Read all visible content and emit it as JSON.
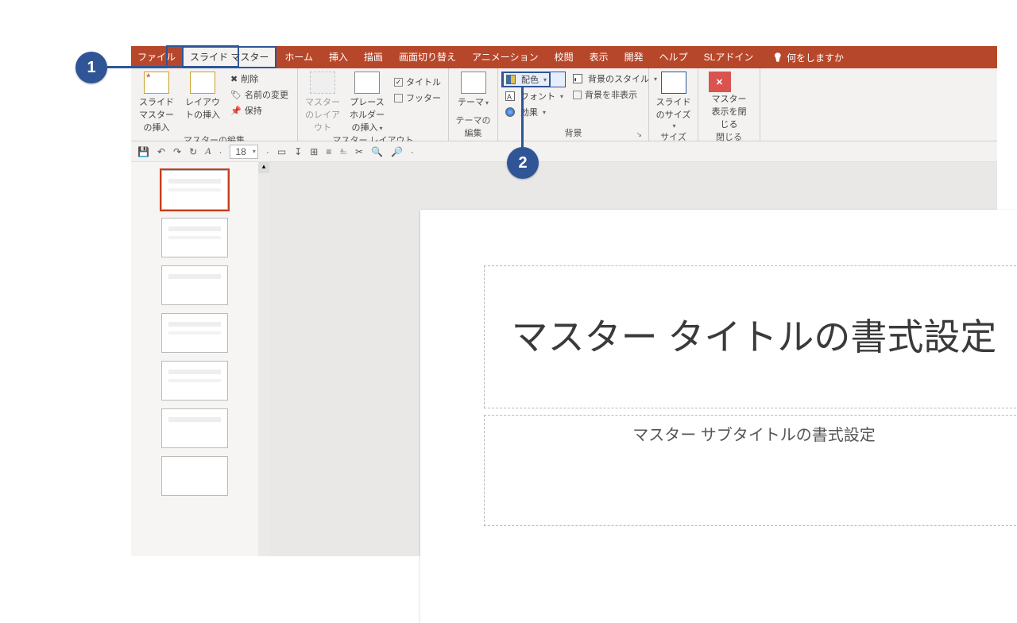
{
  "tabs": {
    "file": "ファイル",
    "slidemaster": "スライド マスター",
    "home": "ホーム",
    "insert": "挿入",
    "draw": "描画",
    "transition": "画面切り替え",
    "animation": "アニメーション",
    "review": "校閲",
    "view": "表示",
    "developer": "開発",
    "help": "ヘルプ",
    "sladdin": "SLアドイン",
    "tellme": "何をしますか"
  },
  "ribbon": {
    "editMaster": {
      "insertSlideMaster": "スライド マスターの挿入",
      "insertLayout": "レイアウトの挿入",
      "delete": "削除",
      "rename": "名前の変更",
      "preserve": "保持",
      "group": "マスターの編集"
    },
    "masterLayout": {
      "masterLayout": "マスターのレイアウト",
      "insertPlaceholder": "プレースホルダーの挿入",
      "titleChk": "タイトル",
      "footerChk": "フッター",
      "group": "マスター レイアウト"
    },
    "editTheme": {
      "theme": "テーマ",
      "group": "テーマの編集"
    },
    "background": {
      "colors": "配色",
      "fonts": "フォント",
      "effects": "効果",
      "bgStyles": "背景のスタイル",
      "hideBg": "背景を非表示",
      "group": "背景"
    },
    "size": {
      "slideSize": "スライドのサイズ",
      "group": "サイズ"
    },
    "close": {
      "closeMaster": "マスター表示を閉じる",
      "group": "閉じる"
    }
  },
  "qat": {
    "fontSize": "18"
  },
  "slide": {
    "title": "マスター タイトルの書式設定",
    "subtitle": "マスター サブタイトルの書式設定"
  },
  "callouts": {
    "c1": "1",
    "c2": "2"
  }
}
